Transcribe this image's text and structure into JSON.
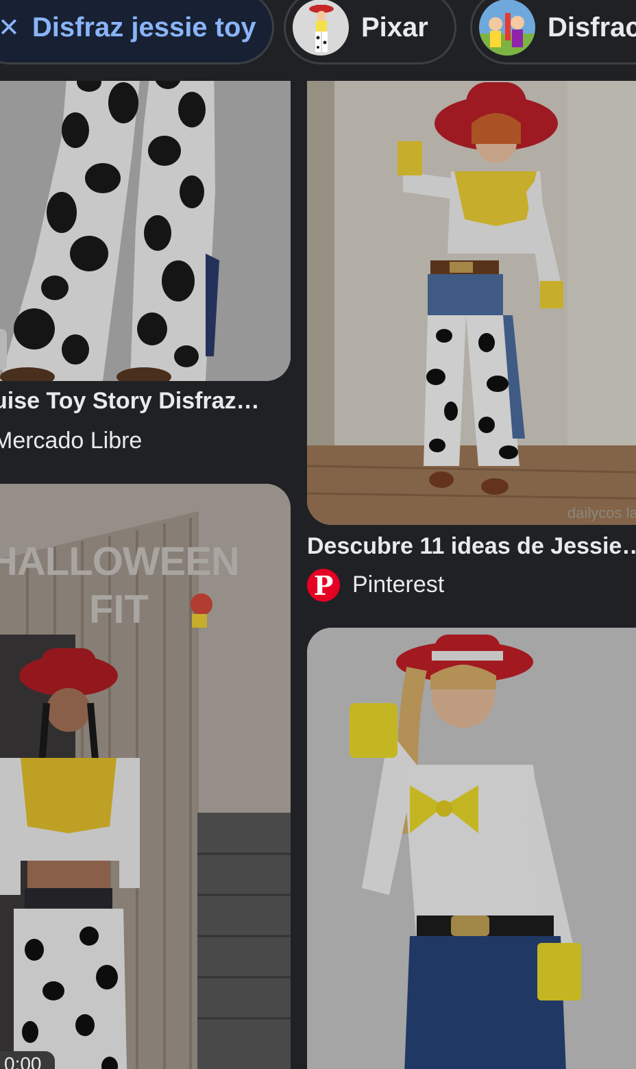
{
  "chips": [
    {
      "label": "Disfraz jessie toy",
      "active": true
    },
    {
      "label": "Pixar",
      "active": false
    },
    {
      "label": "Disfrac",
      "active": false
    }
  ],
  "results": [
    {
      "title": "uise Toy Story Disfraz…",
      "source": "Mercado Libre"
    },
    {
      "title": "Descubre 11 ideas de Jessie…",
      "source": "Pinterest"
    },
    {
      "overlay_text_1": "HALLOWEEN",
      "overlay_text_2": "FIT",
      "duration": "0:00"
    },
    {
      "watermark": "dailycos la"
    }
  ],
  "icons": {
    "close": "close-icon",
    "source_logo": "pinterest-logo-icon",
    "pinterest_letter": "P"
  },
  "colors": {
    "background": "#202124",
    "active_chip_bg": "#172133",
    "active_chip_text": "#8ab4f8",
    "text": "#e8eaed",
    "pinterest_red": "#e60023"
  }
}
